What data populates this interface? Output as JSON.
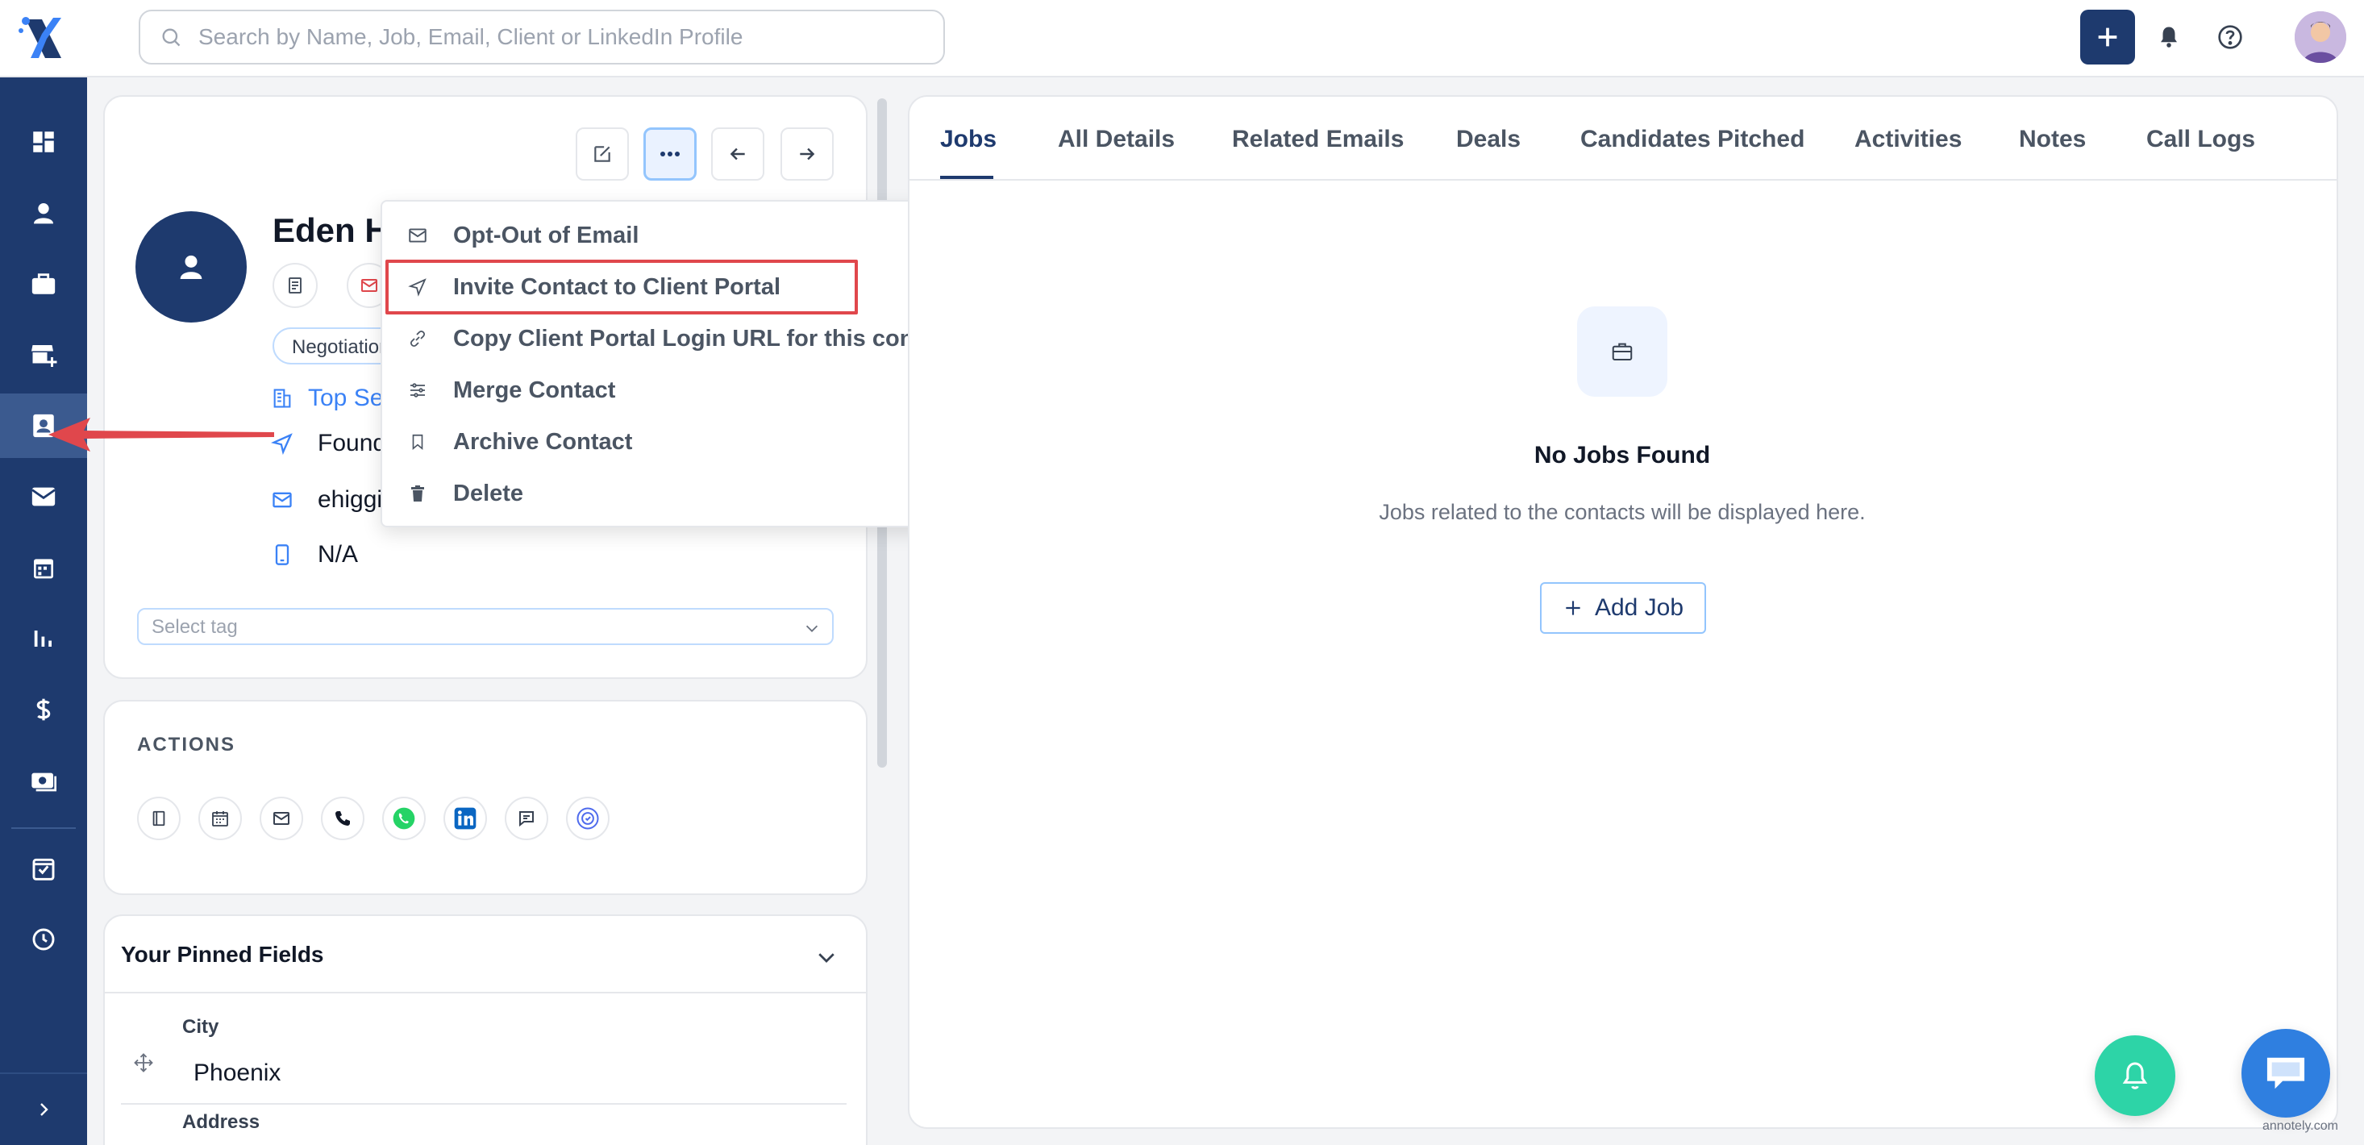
{
  "search": {
    "placeholder": "Search by Name, Job, Email, Client or LinkedIn Profile"
  },
  "profile": {
    "name": "Eden H",
    "stage_tag": "Negotiation",
    "company": "Top Se",
    "title": "Found",
    "email": "ehiggi",
    "phone": "N/A",
    "tag_placeholder": "Select tag"
  },
  "menu": {
    "items": [
      {
        "label": "Opt-Out of Email",
        "icon": "mail-icon"
      },
      {
        "label": "Invite Contact to Client Portal",
        "icon": "send-icon"
      },
      {
        "label": "Copy Client Portal Login URL for this contact",
        "icon": "link-icon"
      },
      {
        "label": "Merge Contact",
        "icon": "sliders-icon"
      },
      {
        "label": "Archive Contact",
        "icon": "bookmark-icon"
      },
      {
        "label": "Delete",
        "icon": "trash-icon"
      }
    ],
    "highlighted_index": 1
  },
  "actions": {
    "title": "ACTIONS"
  },
  "pinned": {
    "title": "Your Pinned Fields",
    "fields": [
      {
        "label": "City",
        "value": "Phoenix"
      },
      {
        "label": "Address",
        "value": ""
      }
    ]
  },
  "tabs": [
    "Jobs",
    "All Details",
    "Related Emails",
    "Deals",
    "Candidates Pitched",
    "Activities",
    "Notes",
    "Call Logs"
  ],
  "active_tab": "Jobs",
  "empty_state": {
    "title": "No Jobs Found",
    "description": "Jobs related to the contacts will be displayed here.",
    "button": "Add Job"
  },
  "watermark": "annotely.com",
  "colors": {
    "brand": "#1e3a6e",
    "highlight": "#e0474c",
    "fab_bell": "#2dd4a7",
    "fab_chat": "#2f7fe0"
  }
}
